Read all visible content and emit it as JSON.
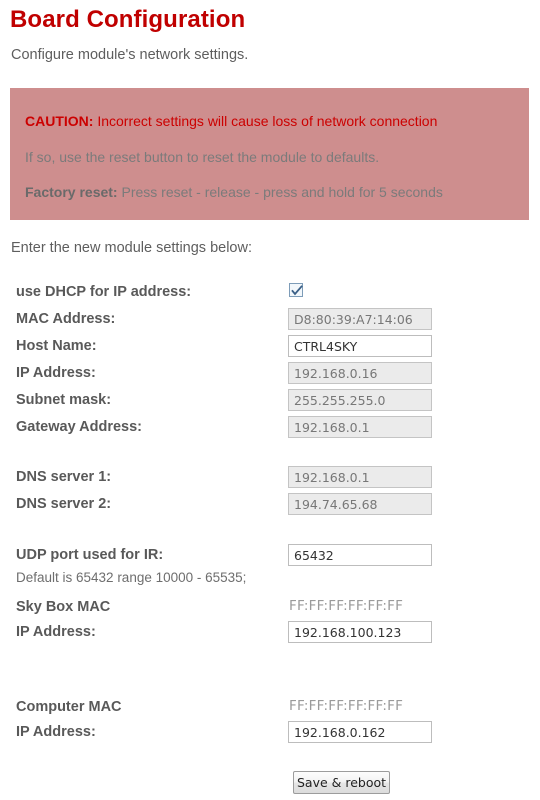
{
  "page": {
    "title": "Board Configuration",
    "subtitle": "Configure module's network settings.",
    "intro": "Enter the new module settings below:"
  },
  "caution": {
    "label": "CAUTION:",
    "message": " Incorrect settings will cause loss of network connection",
    "line2": "If so, use the reset button to reset the module to defaults.",
    "factory_label": "Factory reset:",
    "factory_message": " Press reset - release - press and hold for 5 seconds",
    "bg_color": "#ce8e8e",
    "accent_color": "#cc0000"
  },
  "form": {
    "dhcp": {
      "label": "use DHCP for IP address:",
      "checked": true
    },
    "mac_address": {
      "label": "MAC Address:",
      "value": "D8:80:39:A7:14:06",
      "disabled": true
    },
    "host_name": {
      "label": "Host Name:",
      "value": "CTRL4SKY",
      "disabled": false
    },
    "ip_address": {
      "label": "IP Address:",
      "value": "192.168.0.16",
      "disabled": true
    },
    "subnet_mask": {
      "label": "Subnet mask:",
      "value": "255.255.255.0",
      "disabled": true
    },
    "gateway_address": {
      "label": "Gateway Address:",
      "value": "192.168.0.1",
      "disabled": true
    },
    "dns_server_1": {
      "label": "DNS server 1:",
      "value": "192.168.0.1",
      "disabled": true
    },
    "dns_server_2": {
      "label": "DNS server 2:",
      "value": "194.74.65.68",
      "disabled": true
    },
    "udp_port": {
      "label": "UDP port used for IR:",
      "value": "65432",
      "disabled": false
    },
    "udp_hint": "Default is 65432 range 10000 - 65535;",
    "sky_box_mac": {
      "label": "Sky Box MAC",
      "value": "FF:FF:FF:FF:FF:FF"
    },
    "sky_box_ip": {
      "label": "IP Address:",
      "value": "192.168.100.123",
      "disabled": false
    },
    "computer_mac": {
      "label": "Computer MAC",
      "value": "FF:FF:FF:FF:FF:FF"
    },
    "computer_ip": {
      "label": "IP Address:",
      "value": "192.168.0.162",
      "disabled": false
    },
    "save_button": "Save & reboot"
  }
}
